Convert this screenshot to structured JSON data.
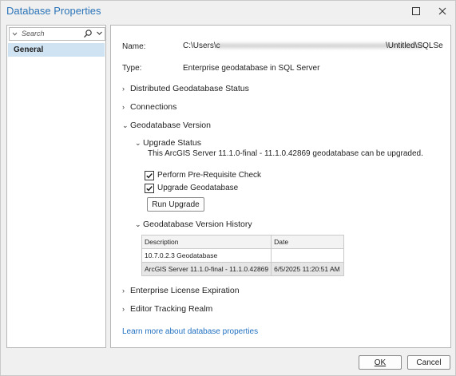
{
  "window": {
    "title": "Database Properties"
  },
  "sidebar": {
    "search_placeholder": "Search",
    "items": [
      {
        "label": "General"
      }
    ]
  },
  "main": {
    "name_label": "Name:",
    "name_prefix": "C:\\Users\\c",
    "name_suffix": "\\Untitled\\SQLSe",
    "type_label": "Type:",
    "type_value": "Enterprise geodatabase in SQL Server",
    "sections": {
      "distributed": "Distributed Geodatabase Status",
      "connections": "Connections",
      "gdb_version": "Geodatabase Version",
      "upgrade_status": "Upgrade Status",
      "upgrade_message": "This ArcGIS Server 11.1.0-final - 11.1.0.42869 geodatabase can be upgraded.",
      "prereq_check": "Perform Pre-Requisite Check",
      "upgrade_gdb": "Upgrade Geodatabase",
      "run_upgrade": "Run Upgrade",
      "version_history": "Geodatabase Version History",
      "license": "Enterprise License Expiration",
      "editor_tracking": "Editor Tracking Realm"
    },
    "checkboxes": {
      "prereq_checked": true,
      "upgrade_checked": true
    },
    "history_table": {
      "headers": [
        "Description",
        "Date"
      ],
      "rows": [
        [
          "10.7.0.2.3 Geodatabase",
          ""
        ],
        [
          "ArcGIS Server 11.1.0-final - 11.1.0.42869",
          "6/5/2025 11:20:51 AM"
        ]
      ]
    },
    "learn_more": "Learn more about database properties"
  },
  "footer": {
    "ok_label": "OK",
    "cancel_label": "Cancel"
  }
}
